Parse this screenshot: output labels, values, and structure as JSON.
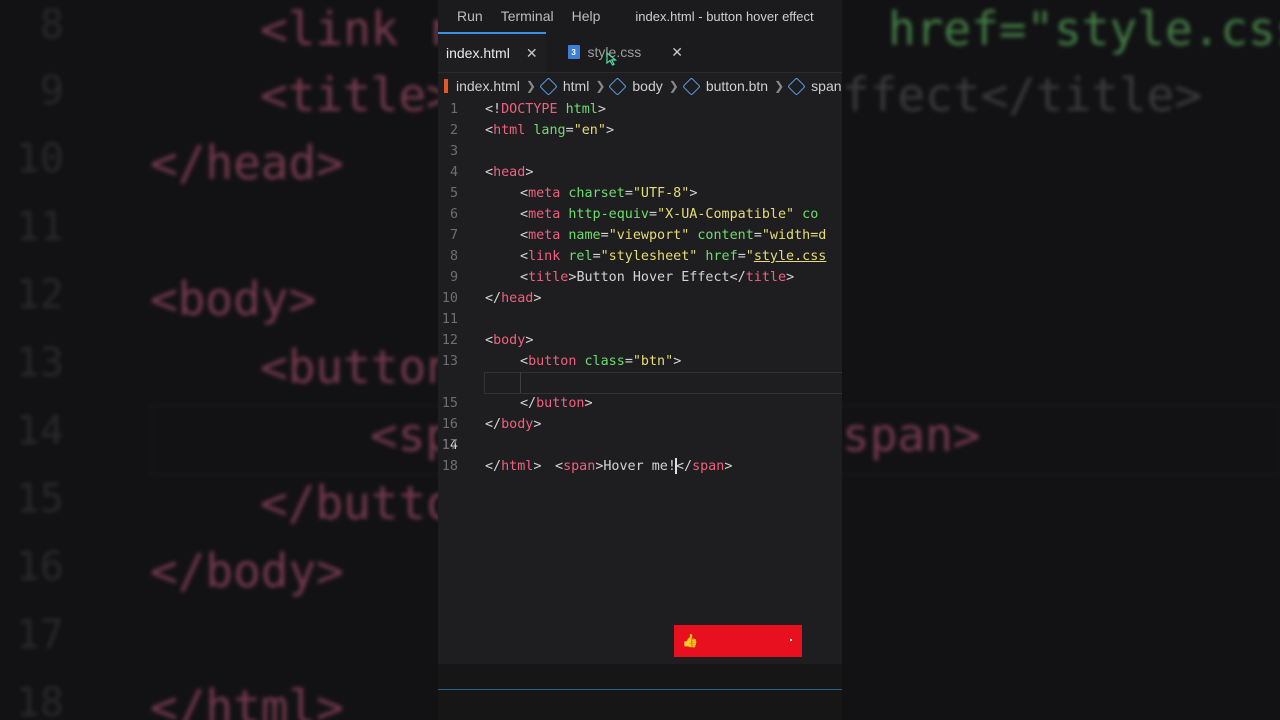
{
  "menubar": {
    "items": [
      "Run",
      "Terminal",
      "Help"
    ],
    "window_title": "index.html - button hover effect"
  },
  "tabs": [
    {
      "label": "index.html",
      "active": true
    },
    {
      "label": "style.css",
      "active": false,
      "icon": "css-icon"
    }
  ],
  "breadcrumb": [
    "index.html",
    "html",
    "body",
    "button.btn",
    "span"
  ],
  "code_lines": [
    {
      "n": "1"
    },
    {
      "n": "2"
    },
    {
      "n": "3"
    },
    {
      "n": "4"
    },
    {
      "n": "5"
    },
    {
      "n": "6"
    },
    {
      "n": "7"
    },
    {
      "n": "8"
    },
    {
      "n": "9"
    },
    {
      "n": "10"
    },
    {
      "n": "11"
    },
    {
      "n": "12"
    },
    {
      "n": "13"
    },
    {
      "n": "14"
    },
    {
      "n": "15"
    },
    {
      "n": "16"
    },
    {
      "n": "17"
    },
    {
      "n": "18"
    }
  ],
  "code": {
    "l1": [
      "<!",
      "DOCTYPE",
      " html",
      ">"
    ],
    "l2": [
      "<",
      "html",
      " lang",
      "=",
      "\"en\"",
      ">"
    ],
    "l4": [
      "<",
      "head",
      ">"
    ],
    "l5": [
      "<",
      "meta",
      " charset",
      "=",
      "\"UTF-8\"",
      ">"
    ],
    "l6": [
      "<",
      "meta",
      " http-equiv",
      "=",
      "\"X-UA-Compatible\"",
      " co"
    ],
    "l7": [
      "<",
      "meta",
      " name",
      "=",
      "\"viewport\"",
      " content",
      "=",
      "\"width=d"
    ],
    "l8": [
      "<",
      "link",
      " rel",
      "=",
      "\"stylesheet\"",
      " href",
      "=",
      "\"",
      "style.css"
    ],
    "l9": [
      "<",
      "title",
      ">",
      "Button Hover Effect",
      "</",
      "title",
      ">"
    ],
    "l10": [
      "</",
      "head",
      ">"
    ],
    "l12": [
      "<",
      "body",
      ">"
    ],
    "l13": [
      "<",
      "button",
      " class",
      "=",
      "\"btn\"",
      ">"
    ],
    "l14": [
      "<",
      "span",
      ">",
      "Hover me!",
      "</",
      "span",
      ">"
    ],
    "l15": [
      "</",
      "button",
      ">"
    ],
    "l16": [
      "</",
      "body",
      ">"
    ],
    "l18": [
      "</",
      "html",
      ">"
    ]
  },
  "background": {
    "lines": [
      {
        "n": "8",
        "code": "<link r",
        "tail": "href=\"style.css"
      },
      {
        "n": "9",
        "code": "<title>",
        "tail": "ffect</title>"
      },
      {
        "n": "10",
        "code": "</head>"
      },
      {
        "n": "11",
        "code": ""
      },
      {
        "n": "12",
        "code": "<body>"
      },
      {
        "n": "13",
        "code": "<button"
      },
      {
        "n": "14",
        "code": "<sp",
        "tail": "span>"
      },
      {
        "n": "15",
        "code": "</butto"
      },
      {
        "n": "16",
        "code": "</body>"
      },
      {
        "n": "17",
        "code": ""
      },
      {
        "n": "18",
        "code": "</html>"
      }
    ]
  },
  "colors": {
    "accent": "#3b8eea",
    "tag": "#f0607e",
    "attr": "#6fdc6f",
    "string": "#e6db74",
    "subscribe": "#e8101f"
  }
}
